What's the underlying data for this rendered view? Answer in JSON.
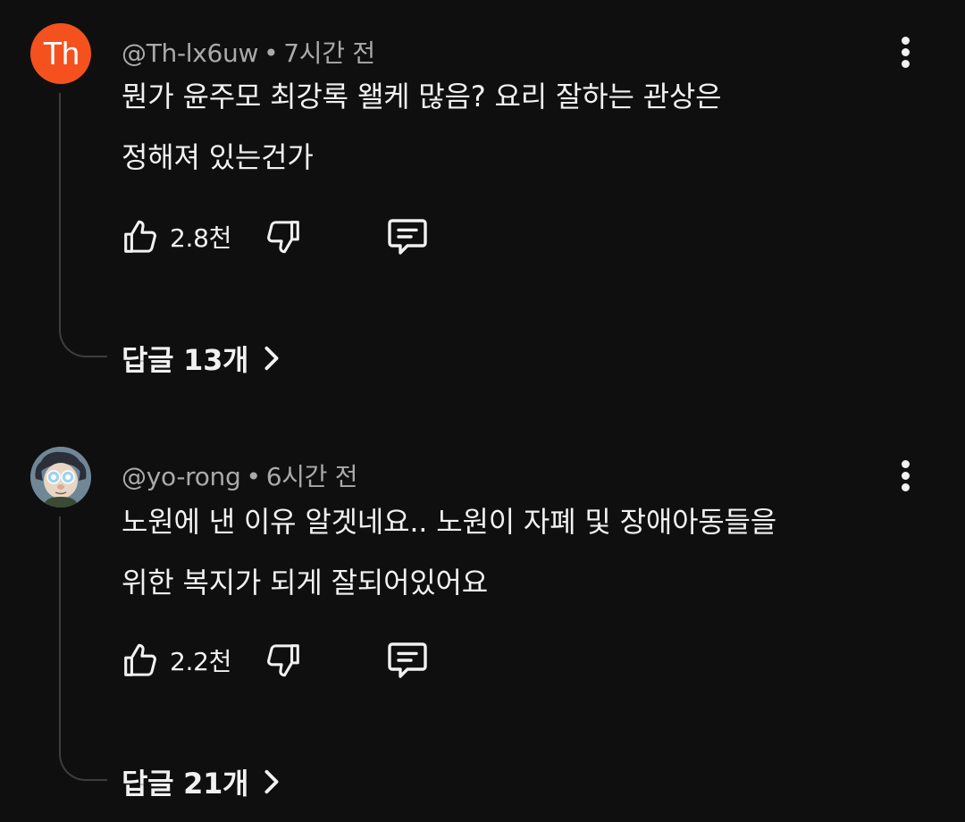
{
  "comments": [
    {
      "avatar": {
        "type": "initials",
        "text": "Th",
        "color": "#f4511e"
      },
      "handle": "@Th-lx6uw",
      "time": "7시간 전",
      "lines": [
        "뭔가 윤주모 최강록 왤케 많음? 요리 잘하는 관상은",
        "정해져 있는건가"
      ],
      "likes": "2.8천",
      "replies_label": "답글 13개"
    },
    {
      "avatar": {
        "type": "image",
        "description": "cartoon-character-avatar"
      },
      "handle": "@yo-rong",
      "time": "6시간 전",
      "lines": [
        "노원에 낸 이유 알겟네요.. 노원이 자폐 및 장애아동들을",
        "위한 복지가 되게 잘되어있어요"
      ],
      "likes": "2.2천",
      "replies_label": "답글 21개"
    }
  ],
  "separator": "•",
  "icons": {
    "like": "thumbs-up-icon",
    "dislike": "thumbs-down-icon",
    "reply": "comment-icon",
    "more": "more-vertical-icon",
    "chevron": "chevron-right-icon"
  },
  "colors": {
    "background": "#0f0f0f",
    "text": "#f1f1f1",
    "secondary_text": "#aaaaaa",
    "thread_line": "#3d3d3d"
  }
}
